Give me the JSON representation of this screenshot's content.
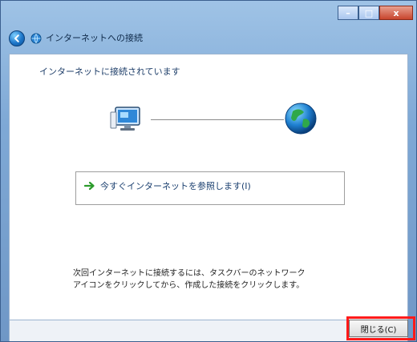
{
  "window": {
    "title": "インターネットへの接続",
    "caption_buttons": {
      "minimize": "–",
      "maximize": "□",
      "close": "x"
    }
  },
  "main": {
    "heading": "インターネットに接続されています",
    "browse_link": "今すぐインターネットを参照します(I)",
    "note_lines": [
      "次回インターネットに接続するには、タスクバーのネットワーク",
      "アイコンをクリックしてから、作成した接続をクリックします。"
    ]
  },
  "footer": {
    "close_label": "閉じる(C)"
  },
  "colors": {
    "highlight_red": "#ff1a1a",
    "link_blue": "#1a3f6f",
    "arrow_green": "#2c9b2c"
  },
  "icons": {
    "back": "back-arrow-icon",
    "app": "network-connection-icon",
    "computer": "computer-icon",
    "globe": "globe-icon",
    "link_arrow": "green-arrow-icon"
  }
}
